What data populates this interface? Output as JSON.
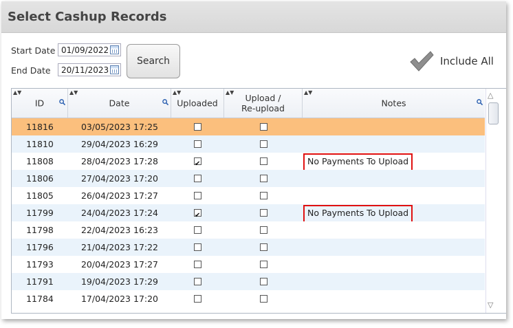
{
  "title": "Select Cashup Records",
  "filters": {
    "start_label": "Start Date",
    "start_value": "01/09/2022",
    "end_label": "End Date",
    "end_value": "20/11/2023",
    "search_label": "Search",
    "include_all_label": "Include All"
  },
  "columns": {
    "id": "ID",
    "date": "Date",
    "uploaded": "Uploaded",
    "reupload_1": "Upload /",
    "reupload_2": "Re-upload",
    "notes": "Notes"
  },
  "rows": [
    {
      "id": "11816",
      "date": "03/05/2023 17:25",
      "uploaded": false,
      "reupload": false,
      "notes": "",
      "selected": true
    },
    {
      "id": "11810",
      "date": "29/04/2023 16:29",
      "uploaded": false,
      "reupload": false,
      "notes": ""
    },
    {
      "id": "11808",
      "date": "28/04/2023 17:28",
      "uploaded": true,
      "reupload": false,
      "notes": "No Payments To Upload"
    },
    {
      "id": "11806",
      "date": "27/04/2023 17:20",
      "uploaded": false,
      "reupload": false,
      "notes": ""
    },
    {
      "id": "11805",
      "date": "26/04/2023 17:27",
      "uploaded": false,
      "reupload": false,
      "notes": ""
    },
    {
      "id": "11799",
      "date": "24/04/2023 17:24",
      "uploaded": true,
      "reupload": false,
      "notes": "No Payments To Upload"
    },
    {
      "id": "11798",
      "date": "22/04/2023 16:23",
      "uploaded": false,
      "reupload": false,
      "notes": ""
    },
    {
      "id": "11796",
      "date": "21/04/2023 17:22",
      "uploaded": false,
      "reupload": false,
      "notes": ""
    },
    {
      "id": "11793",
      "date": "20/04/2023 17:27",
      "uploaded": false,
      "reupload": false,
      "notes": ""
    },
    {
      "id": "11791",
      "date": "19/04/2023 17:29",
      "uploaded": false,
      "reupload": false,
      "notes": ""
    },
    {
      "id": "11784",
      "date": "17/04/2023 17:20",
      "uploaded": false,
      "reupload": false,
      "notes": ""
    }
  ],
  "colors": {
    "selected_row": "#fbbf7d",
    "alt_row": "#eaf3fb",
    "note_border": "#e01010"
  }
}
